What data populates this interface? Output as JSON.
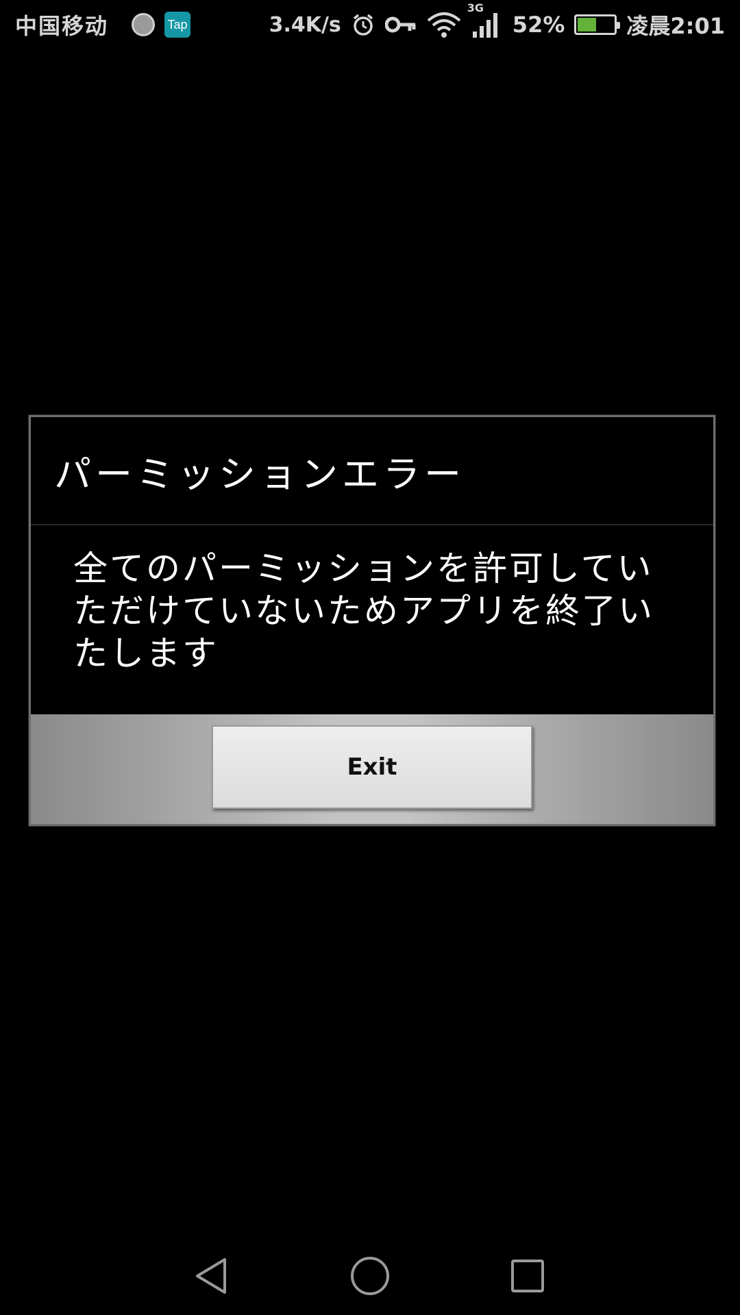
{
  "status_bar": {
    "carrier": "中国移动",
    "app_icons": [
      "round-app-icon",
      "tap-icon"
    ],
    "tap_label": "Tap",
    "net_speed": "3.4K/s",
    "network_type": "3G",
    "battery_percent": "52%",
    "battery_level": 0.52,
    "battery_color": "#63b23a",
    "time": "凌晨2:01",
    "icons": [
      "alarm-icon",
      "key-icon",
      "wifi-icon",
      "signal-icon",
      "battery-icon"
    ]
  },
  "dialog": {
    "title": "パーミッションエラー",
    "message": "全てのパーミッションを許可していただけていないためアプリを終了いたします",
    "exit_label": "Exit"
  },
  "nav_bar": {
    "buttons": [
      "back-icon",
      "home-icon",
      "recents-icon"
    ]
  }
}
